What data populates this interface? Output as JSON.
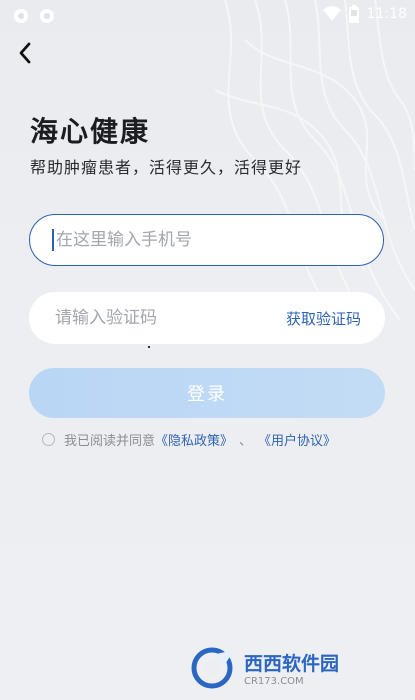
{
  "status_bar": {
    "time": "11:18",
    "icons": [
      "notification-dot-icon",
      "notification-dot-icon",
      "wifi-icon",
      "battery-icon"
    ]
  },
  "nav": {
    "back_icon": "chevron-left-icon"
  },
  "header": {
    "title": "海心健康",
    "subtitle": "帮助肿瘤患者，活得更久，活得更好"
  },
  "form": {
    "phone_placeholder": "在这里输入手机号",
    "phone_value": "",
    "code_placeholder": "请输入验证码",
    "code_value": "",
    "get_code_label": "获取验证码",
    "login_label": "登录"
  },
  "agreement": {
    "checked": false,
    "prefix": "我已阅读并同意",
    "privacy_link": "《隐私政策》",
    "separator": "、",
    "user_agreement_link": "《用户协议》"
  },
  "watermark": {
    "title": "西西软件园",
    "subtitle": "CR173.COM"
  },
  "colors": {
    "accent": "#2f63b3",
    "login_button": "#bcd8f5",
    "background": "#eceef1"
  }
}
